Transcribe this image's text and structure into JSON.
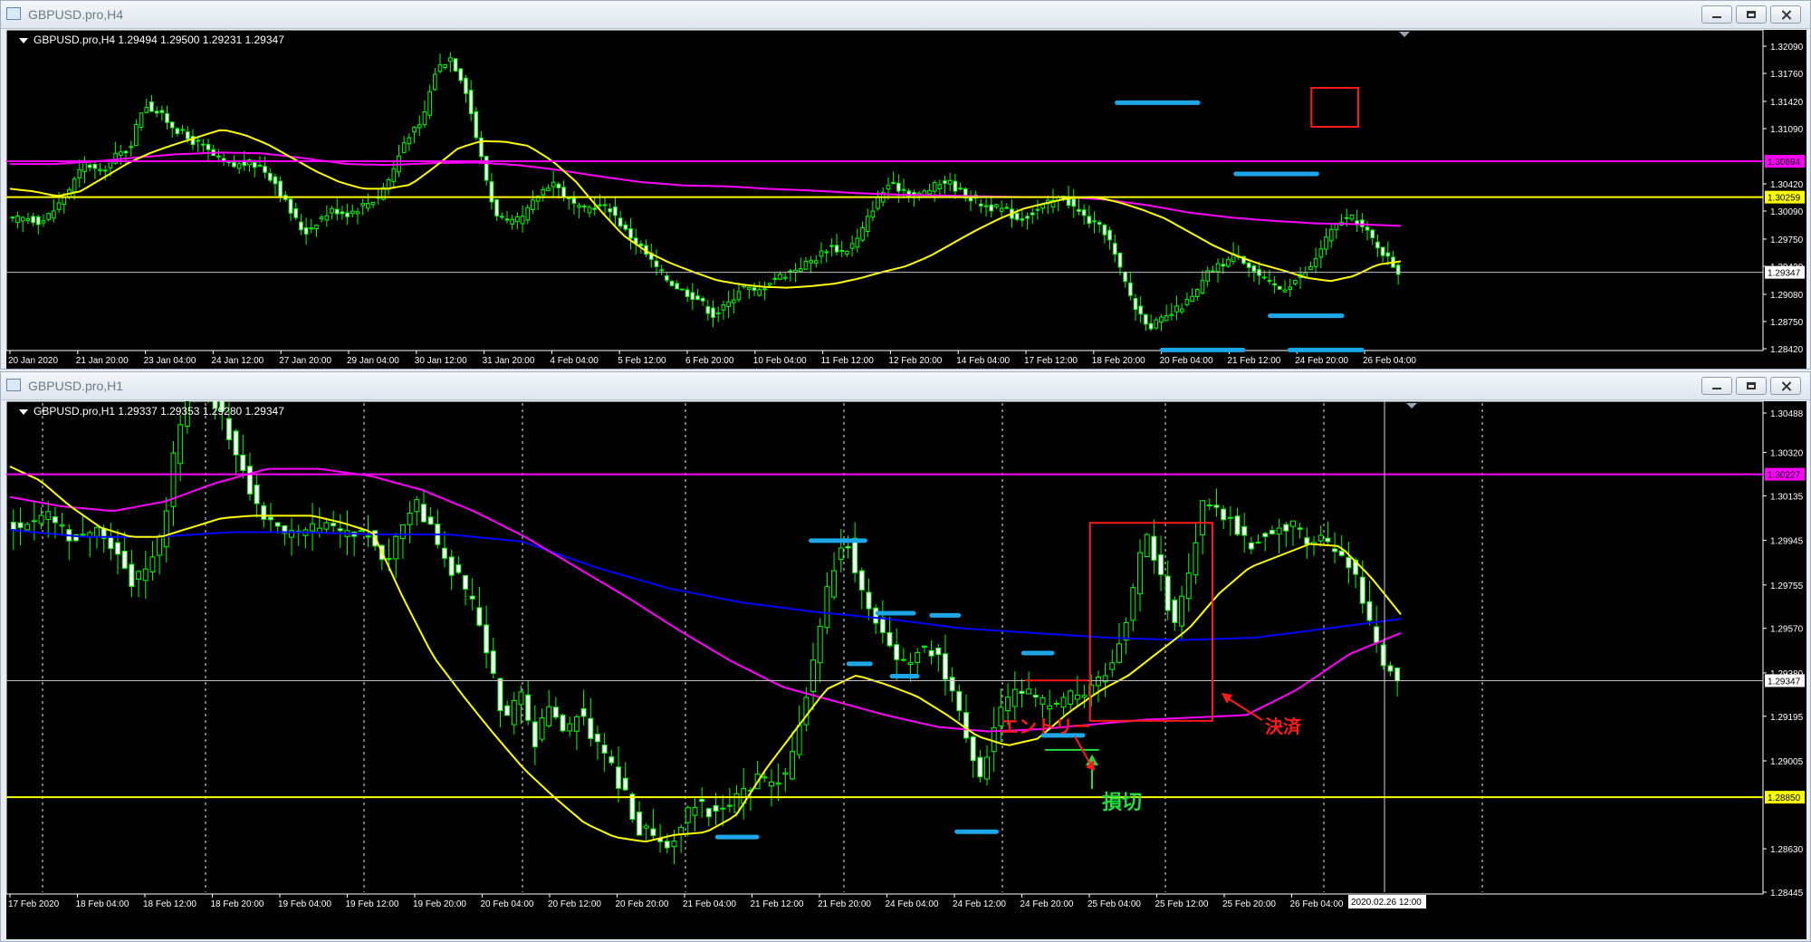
{
  "colors": {
    "bull": "#00ff00",
    "ma_fast": "#ffff00",
    "ma_magenta": "#ff00ff",
    "ma_blue": "#0000ff",
    "annot_blue": "#1ea7e8",
    "annot_red": "#ff1a1a",
    "annot_green": "#22dd44",
    "price_line": "#c0c0c0"
  },
  "top": {
    "title": "GBPUSD.pro,H4",
    "info": "GBPUSD.pro,H4  1.29494 1.29500 1.29231 1.29347",
    "price_axis": [
      "1.32090",
      "1.31760",
      "1.31420",
      "1.31090",
      "1.30420",
      "1.30090",
      "1.29750",
      "1.29420",
      "1.29080",
      "1.28750",
      "1.28420"
    ],
    "price_range": [
      1.2842,
      1.3209
    ],
    "time_axis": [
      "20 Jan 2020",
      "21 Jan 20:00",
      "23 Jan 04:00",
      "24 Jan 12:00",
      "27 Jan 20:00",
      "29 Jan 04:00",
      "30 Jan 12:00",
      "31 Jan 20:00",
      "4 Feb 04:00",
      "5 Feb 12:00",
      "6 Feb 20:00",
      "10 Feb 04:00",
      "11 Feb 12:00",
      "12 Feb 20:00",
      "14 Feb 04:00",
      "17 Feb 12:00",
      "18 Feb 20:00",
      "20 Feb 04:00",
      "21 Feb 12:00",
      "24 Feb 20:00",
      "26 Feb 04:00"
    ],
    "levels": [
      {
        "price": 1.30694,
        "label": "1.30694",
        "color": "#ff00ff"
      },
      {
        "price": 1.30259,
        "label": "1.30259",
        "color": "#ffff00"
      },
      {
        "price": 1.29347,
        "label": "1.29347",
        "color": "#c0c0c0"
      }
    ],
    "close_path": [
      1.2998,
      1.3001,
      1.2996,
      1.3013,
      1.3039,
      1.3068,
      1.3055,
      1.3075,
      1.3085,
      1.314,
      1.3128,
      1.3112,
      1.3097,
      1.3088,
      1.3072,
      1.3063,
      1.3067,
      1.3064,
      1.3044,
      1.301,
      1.2982,
      1.2999,
      1.3011,
      1.3006,
      1.3016,
      1.3025,
      1.3054,
      1.31,
      1.3112,
      1.318,
      1.3196,
      1.3162,
      1.3083,
      1.301,
      1.2992,
      1.3001,
      1.3028,
      1.3046,
      1.3024,
      1.3009,
      1.3016,
      1.3012,
      1.2985,
      1.2967,
      1.2943,
      1.2924,
      1.2912,
      1.2903,
      1.2883,
      1.2895,
      1.2919,
      1.2909,
      1.2926,
      1.2933,
      1.2942,
      1.2951,
      1.2967,
      1.2959,
      1.2976,
      1.3014,
      1.3041,
      1.3036,
      1.3027,
      1.3037,
      1.3046,
      1.3033,
      1.3021,
      1.3014,
      1.301,
      1.2999,
      1.3008,
      1.3018,
      1.3027,
      1.3009,
      1.2994,
      1.2983,
      1.2934,
      1.2891,
      1.287,
      1.2878,
      1.2892,
      1.2905,
      1.2935,
      1.2946,
      1.2958,
      1.2938,
      1.2922,
      1.2914,
      1.2926,
      1.294,
      1.2974,
      1.2997,
      1.3,
      1.298,
      1.2958,
      1.2935
    ],
    "ma_fast": [
      1.3036,
      1.3033,
      1.3027,
      1.3033,
      1.305,
      1.3067,
      1.308,
      1.309,
      1.3099,
      1.3108,
      1.3101,
      1.3089,
      1.3073,
      1.3057,
      1.3044,
      1.3036,
      1.3036,
      1.3041,
      1.3062,
      1.3085,
      1.3094,
      1.3093,
      1.3088,
      1.307,
      1.3045,
      1.3011,
      1.298,
      1.296,
      1.2946,
      1.2935,
      1.2925,
      1.292,
      1.2917,
      1.2916,
      1.2918,
      1.2921,
      1.2927,
      1.2935,
      1.2942,
      1.2954,
      1.297,
      1.2986,
      1.3,
      1.3012,
      1.3019,
      1.3025,
      1.3026,
      1.302,
      1.3011,
      1.3,
      1.2984,
      1.2968,
      1.2955,
      1.2945,
      1.2937,
      1.2928,
      1.2924,
      1.293,
      1.2944,
      1.2948
    ],
    "ma_magenta": [
      1.3066,
      1.3066,
      1.3069,
      1.3074,
      1.3078,
      1.308,
      1.3079,
      1.3073,
      1.3066,
      1.3065,
      1.3067,
      1.3068,
      1.3065,
      1.3059,
      1.3051,
      1.3044,
      1.304,
      1.3039,
      1.3036,
      1.3034,
      1.3031,
      1.3029,
      1.3028,
      1.3027,
      1.3026,
      1.3026,
      1.3023,
      1.3016,
      1.3007,
      1.3001,
      1.2997,
      1.2994,
      1.2993,
      1.2991
    ],
    "annotations": {
      "blue_dashes": [
        [
          0.617,
          0.045,
          0.215
        ],
        [
          0.683,
          0.045,
          0.425
        ],
        [
          0.642,
          0.045,
          0.945
        ],
        [
          0.702,
          0.04,
          0.844
        ],
        [
          0.713,
          0.04,
          0.945
        ]
      ],
      "red_box": [
        0.725,
        0.171,
        0.751,
        0.286
      ]
    }
  },
  "bottom": {
    "title": "GBPUSD.pro,H1",
    "info": "GBPUSD.pro,H1  1.29337 1.29353 1.29280 1.29347",
    "price_axis": [
      "1.30488",
      "1.30320",
      "1.30135",
      "1.29945",
      "1.29755",
      "1.29570",
      "1.29380",
      "1.29195",
      "1.29005",
      "1.28630",
      "1.28445"
    ],
    "price_range": [
      1.28445,
      1.30488
    ],
    "time_axis": [
      "17 Feb 2020",
      "18 Feb 04:00",
      "18 Feb 12:00",
      "18 Feb 20:00",
      "19 Feb 04:00",
      "19 Feb 12:00",
      "19 Feb 20:00",
      "20 Feb 04:00",
      "20 Feb 12:00",
      "20 Feb 20:00",
      "21 Feb 04:00",
      "21 Feb 12:00",
      "21 Feb 20:00",
      "24 Feb 04:00",
      "24 Feb 12:00",
      "24 Feb 20:00",
      "25 Feb 04:00",
      "25 Feb 12:00",
      "25 Feb 20:00",
      "26 Feb 04:00"
    ],
    "crosshair_label": "2020.02.26 12:00",
    "levels": [
      {
        "price": 1.30227,
        "label": "1.30227",
        "color": "#ff00ff"
      },
      {
        "price": 1.2885,
        "label": "1.28850",
        "color": "#ffff00"
      },
      {
        "price": 1.29347,
        "label": "1.29347",
        "color": "#c0c0c0"
      }
    ],
    "close_path": [
      1.3,
      1.3003,
      1.3006,
      1.3002,
      1.2995,
      1.2997,
      1.2999,
      1.2989,
      1.2976,
      1.2982,
      1.2996,
      1.304,
      1.3066,
      1.3058,
      1.3048,
      1.303,
      1.3015,
      1.3003,
      1.2999,
      1.2996,
      1.2999,
      1.3,
      1.2998,
      1.2999,
      1.2996,
      1.2985,
      1.3001,
      1.301,
      1.3,
      1.2985,
      1.2978,
      1.2965,
      1.2942,
      1.2915,
      1.293,
      1.2908,
      1.2925,
      1.291,
      1.2924,
      1.2908,
      1.29,
      1.2887,
      1.2872,
      1.2868,
      1.2864,
      1.2876,
      1.2884,
      1.2878,
      1.288,
      1.2886,
      1.2892,
      1.289,
      1.2896,
      1.292,
      1.2952,
      1.2982,
      1.2996,
      1.2972,
      1.296,
      1.2948,
      1.2942,
      1.2949,
      1.2947,
      1.293,
      1.2912,
      1.2894,
      1.2917,
      1.2928,
      1.2932,
      1.2925,
      1.2924,
      1.2928,
      1.293,
      1.2935,
      1.2945,
      1.2966,
      1.2997,
      1.2982,
      1.2956,
      1.2982,
      1.3013,
      1.3007,
      1.3002,
      1.2992,
      1.2997,
      1.2999,
      1.3,
      1.2992,
      1.2994,
      1.2992,
      1.2982,
      1.296,
      1.2942,
      1.2935
    ],
    "ma_fast": [
      1.3026,
      1.302,
      1.3009,
      1.3,
      1.2996,
      1.2996,
      1.3,
      1.3004,
      1.3005,
      1.3005,
      1.3005,
      1.3002,
      1.2998,
      1.297,
      1.2945,
      1.2928,
      1.2912,
      1.2897,
      1.2885,
      1.2874,
      1.2868,
      1.2866,
      1.2869,
      1.287,
      1.2877,
      1.2897,
      1.2914,
      1.2931,
      1.2937,
      1.2933,
      1.2928,
      1.292,
      1.2911,
      1.2907,
      1.291,
      1.2921,
      1.293,
      1.2937,
      1.2947,
      1.2957,
      1.2972,
      1.2983,
      1.2988,
      1.2993,
      1.2992,
      1.2979,
      1.2963
    ],
    "ma_magenta": [
      1.3013,
      1.3009,
      1.3007,
      1.3011,
      1.3019,
      1.3025,
      1.3025,
      1.3022,
      1.3016,
      1.3007,
      1.2996,
      1.2983,
      1.297,
      1.2956,
      1.2943,
      1.2932,
      1.2926,
      1.292,
      1.2915,
      1.2913,
      1.2914,
      1.2916,
      1.2918,
      1.2919,
      1.292,
      1.2931,
      1.2946,
      1.2955
    ],
    "ma_blue": [
      1.2999,
      1.2996,
      1.2996,
      1.2998,
      1.2998,
      1.2997,
      1.2997,
      1.2994,
      1.2983,
      1.2974,
      1.2968,
      1.2964,
      1.2961,
      1.2957,
      1.2955,
      1.2953,
      1.2952,
      1.2953,
      1.2957,
      1.2961
    ],
    "annotations": {
      "blue_dashes": [
        [
          0.447,
          0.03,
          0.259
        ],
        [
          0.484,
          0.02,
          0.394
        ],
        [
          0.514,
          0.015,
          0.398
        ],
        [
          0.468,
          0.012,
          0.488
        ],
        [
          0.492,
          0.014,
          0.511
        ],
        [
          0.565,
          0.016,
          0.468
        ],
        [
          0.576,
          0.022,
          0.621
        ],
        [
          0.395,
          0.022,
          0.81
        ],
        [
          0.528,
          0.022,
          0.8
        ]
      ],
      "green_stop": [
        0.577,
        0.03,
        0.648
      ],
      "red_entry": [
        0.566,
        0.035,
        0.519
      ],
      "red_box": [
        0.602,
        0.226,
        0.67,
        0.594
      ],
      "entry_label": "エントリー",
      "close_label": "決済",
      "stop_label": "損切"
    }
  }
}
